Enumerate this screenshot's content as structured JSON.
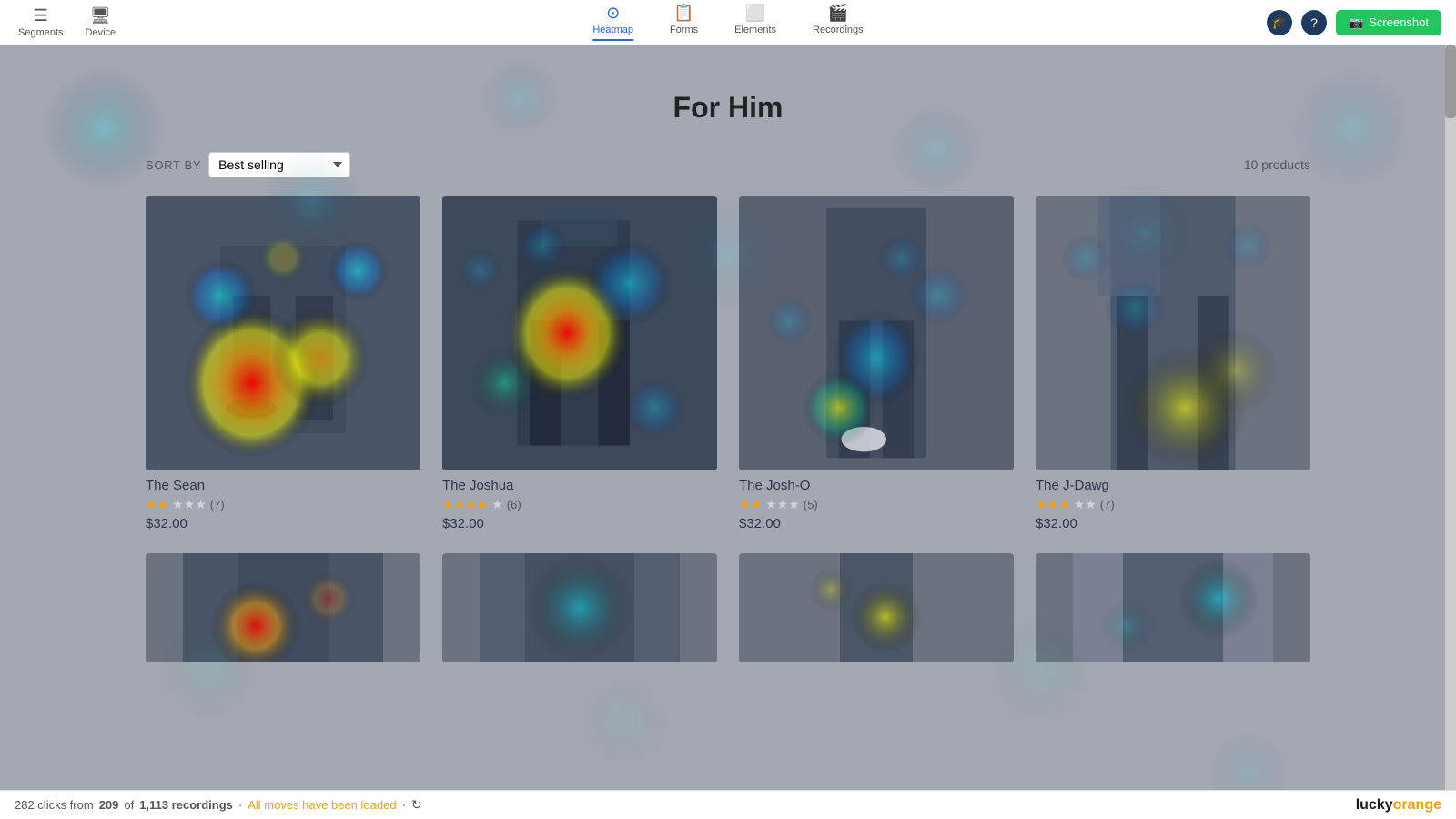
{
  "topnav": {
    "left_items": [
      {
        "id": "segments",
        "icon": "☰",
        "label": "Segments"
      },
      {
        "id": "device",
        "icon": "🖥",
        "label": "Device"
      }
    ],
    "center_tabs": [
      {
        "id": "heatmap",
        "icon": "⊙",
        "label": "Heatmap",
        "active": true
      },
      {
        "id": "forms",
        "icon": "📋",
        "label": "Forms",
        "active": false
      },
      {
        "id": "elements",
        "icon": "⬜",
        "label": "Elements",
        "active": false
      },
      {
        "id": "recordings",
        "icon": "🎬",
        "label": "Recordings",
        "active": false
      }
    ],
    "screenshot_label": "Screenshot"
  },
  "page": {
    "title": "For Him",
    "sort_label": "SORT BY",
    "sort_value": "Best selling",
    "products_count": "10 products",
    "products": [
      {
        "name": "The Sean",
        "stars_filled": 2,
        "stars_empty": 3,
        "review_count": "(7)",
        "price": "$32.00"
      },
      {
        "name": "The Joshua",
        "stars_filled": 4,
        "stars_empty": 1,
        "review_count": "(6)",
        "price": "$32.00"
      },
      {
        "name": "The Josh-O",
        "stars_filled": 2,
        "stars_empty": 3,
        "review_count": "(5)",
        "price": "$32.00"
      },
      {
        "name": "The J-Dawg",
        "stars_filled": 3,
        "stars_empty": 2,
        "review_count": "(7)",
        "price": "$32.00"
      }
    ]
  },
  "bottombar": {
    "clicks": "282 clicks from",
    "of_label": "of",
    "current_recordings": "209",
    "total_recordings": "1,113 recordings",
    "all_moves_label": "All moves have been loaded",
    "logo": "lucky",
    "logo_orange": "orange"
  }
}
